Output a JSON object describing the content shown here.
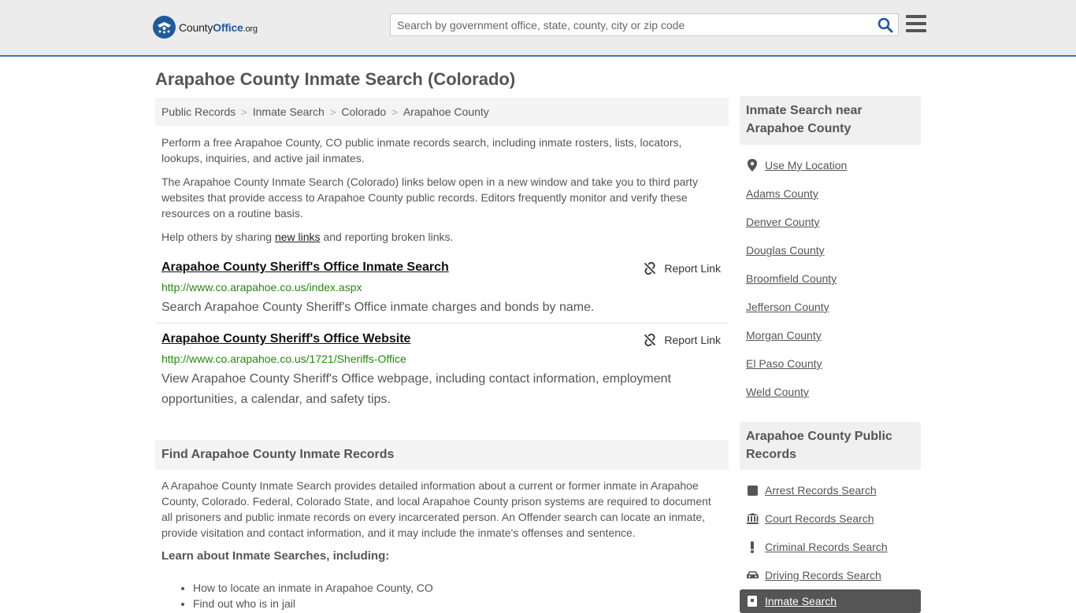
{
  "header": {
    "logo": {
      "brand": "County",
      "office": "Office",
      "tld": ".org"
    },
    "search_placeholder": "Search by government office, state, county, city or zip code"
  },
  "page_title": "Arapahoe County Inmate Search (Colorado)",
  "breadcrumb": [
    "Public Records",
    "Inmate Search",
    "Colorado",
    "Arapahoe County"
  ],
  "intro": {
    "p1": "Perform a free Arapahoe County, CO public inmate records search, including inmate rosters, lists, locators, lookups, inquiries, and active jail inmates.",
    "p2": "The Arapahoe County Inmate Search (Colorado) links below open in a new window and take you to third party websites that provide access to Arapahoe County public records. Editors frequently monitor and verify these resources on a routine basis.",
    "p3_before": "Help others by sharing ",
    "p3_link": "new links",
    "p3_after": " and reporting broken links."
  },
  "links": [
    {
      "title": "Arapahoe County Sheriff's Office Inmate Search",
      "url": "http://www.co.arapahoe.co.us/index.aspx",
      "description": "Search Arapahoe County Sheriff's Office inmate charges and bonds by name.",
      "report_label": "Report Link"
    },
    {
      "title": "Arapahoe County Sheriff's Office Website",
      "url": "http://www.co.arapahoe.co.us/1721/Sheriffs-Office",
      "description": "View Arapahoe County Sheriff's Office webpage, including contact information, employment opportunities, a calendar, and safety tips.",
      "report_label": "Report Link"
    }
  ],
  "records_section": {
    "heading": "Find Arapahoe County Inmate Records",
    "text": "A Arapahoe County Inmate Search provides detailed information about a current or former inmate in Arapahoe County, Colorado. Federal, Colorado State, and local Arapahoe County prison systems are required to document all prisoners and public inmate records on every incarcerated person. An Offender search can locate an inmate, provide visitation and contact information, and it may include the inmate's offenses and sentence.",
    "learn_heading": "Learn about Inmate Searches, including:",
    "learn_items": [
      "How to locate an inmate in Arapahoe County, CO",
      "Find out who is in jail"
    ]
  },
  "sidebar": {
    "near_heading": "Inmate Search near Arapahoe County",
    "use_location": "Use My Location",
    "near_items": [
      "Adams County",
      "Denver County",
      "Douglas County",
      "Broomfield County",
      "Jefferson County",
      "Morgan County",
      "El Paso County",
      "Weld County"
    ],
    "records_heading": "Arapahoe County Public Records",
    "records_items": [
      {
        "label": "Arrest Records Search",
        "icon": "square-icon"
      },
      {
        "label": "Court Records Search",
        "icon": "courthouse-icon"
      },
      {
        "label": "Criminal Records Search",
        "icon": "exclamation-icon"
      },
      {
        "label": "Driving Records Search",
        "icon": "car-icon"
      }
    ],
    "active_item": {
      "label": "Inmate Search",
      "icon": "badge-icon"
    }
  },
  "colors": {
    "accent": "#3a78b5",
    "url_green": "#26880f",
    "logo_blue": "#1f5a9c"
  }
}
